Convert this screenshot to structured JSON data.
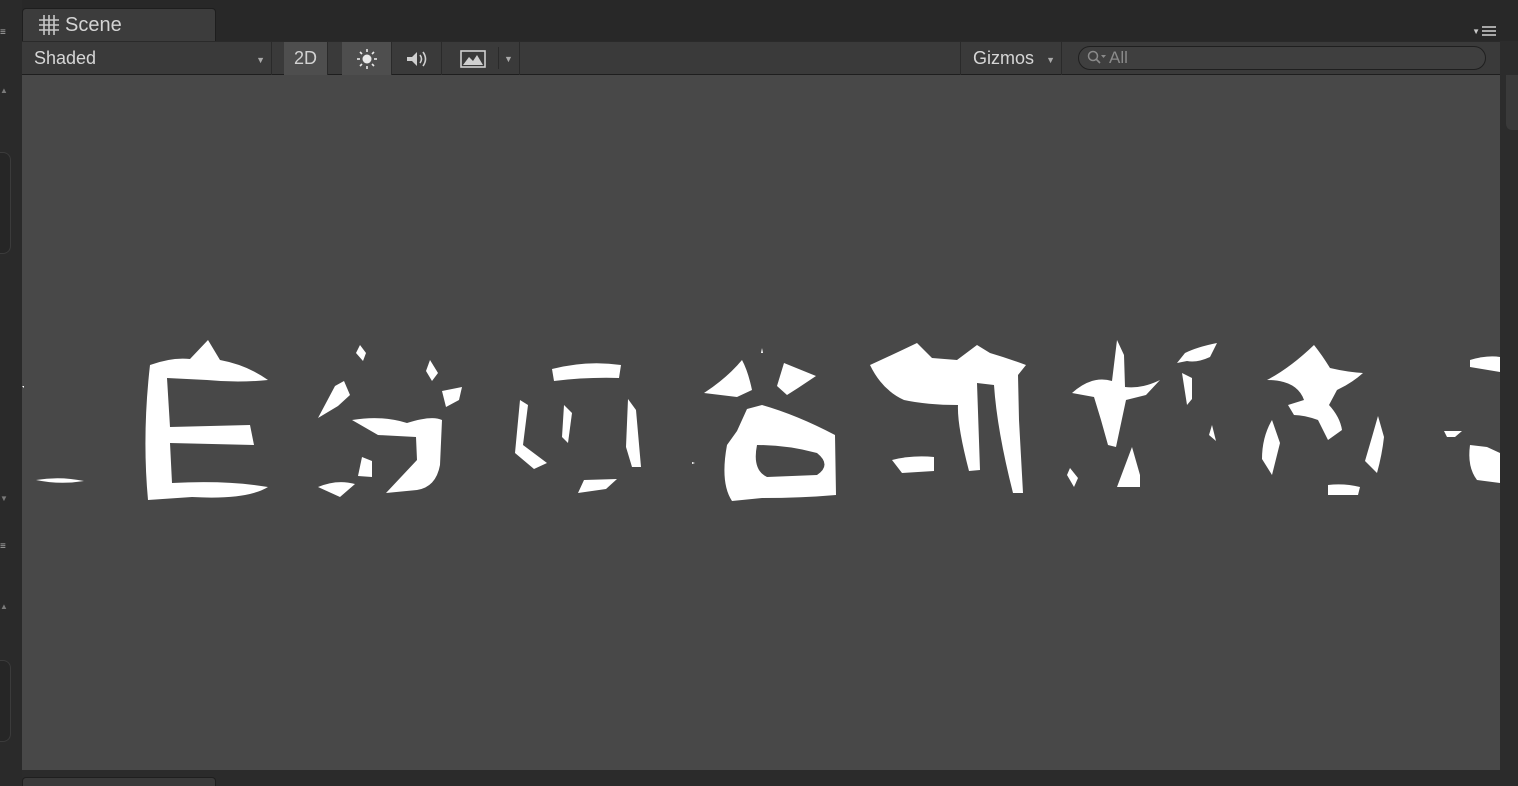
{
  "window": {
    "tab_label": "Scene"
  },
  "toolbar": {
    "draw_mode": "Shaded",
    "mode_2d_label": "2D",
    "gizmos_label": "Gizmos",
    "search_placeholder": "All"
  },
  "icons": {
    "scene_tab": "grid-hash-icon",
    "lighting": "sun-icon",
    "audio": "speaker-icon",
    "effects": "image-icon",
    "panel_menu": "menu-lines-icon",
    "search": "magnifier-icon"
  },
  "colors": {
    "viewport_bg": "#484848",
    "toolbar_bg": "#3a3a3a",
    "active_toggle": "#4e4e4e",
    "glyph_fill": "#ffffff"
  }
}
